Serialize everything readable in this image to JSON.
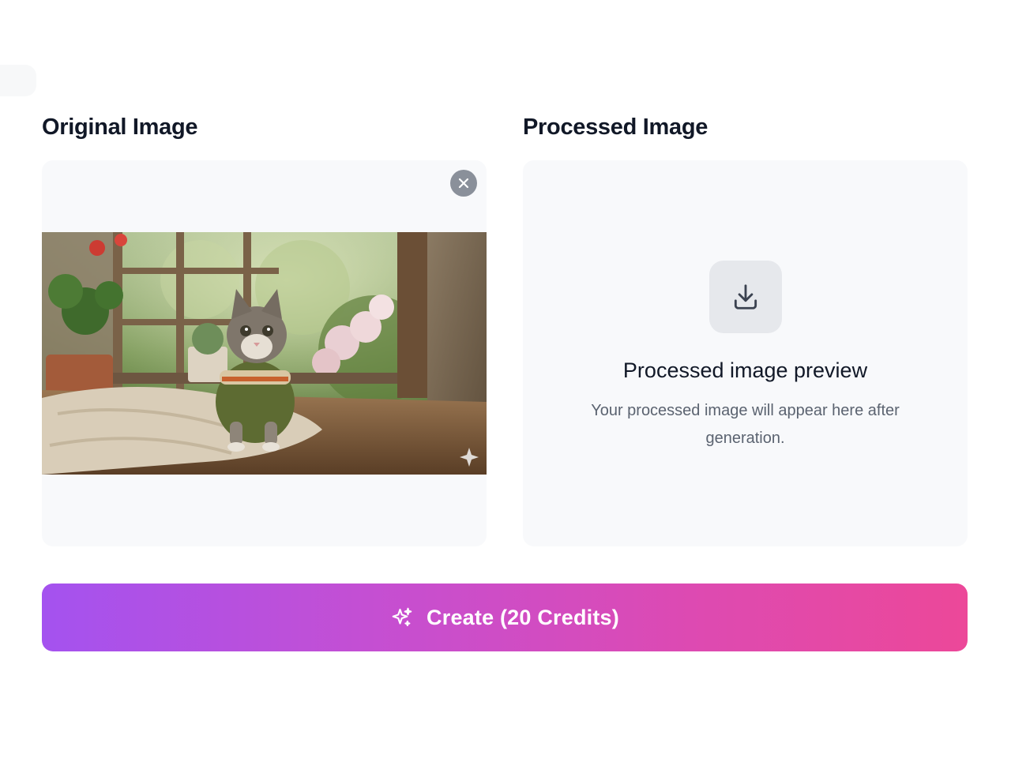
{
  "left_panel": {
    "title": "Original Image",
    "remove_icon": "close-icon"
  },
  "right_panel": {
    "title": "Processed Image",
    "icon": "download-icon",
    "empty_title": "Processed image preview",
    "empty_description": "Your processed image will appear here after generation."
  },
  "create_button": {
    "icon": "sparkles-icon",
    "label": "Create (20 Credits)"
  },
  "colors": {
    "gradient_start": "#a452ef",
    "gradient_end": "#ec4899",
    "panel_bg": "#f8f9fb"
  }
}
